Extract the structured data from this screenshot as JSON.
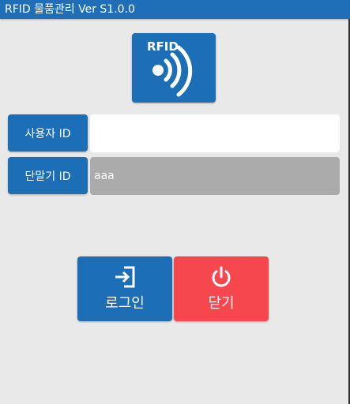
{
  "app": {
    "title": "RFID 물품관리 Ver S1.0.0"
  },
  "logo": {
    "text": "RFID",
    "icon": "rfid-icon"
  },
  "form": {
    "user_id_label": "사용자 ID",
    "user_id_value": "",
    "device_id_label": "단말기 ID",
    "device_id_value": "aaa"
  },
  "buttons": {
    "login_label": "로그인",
    "login_icon": "login-icon",
    "close_label": "닫기",
    "close_icon": "power-icon"
  },
  "colors": {
    "title_bar": "#1e6fb8",
    "primary": "#1c6eb7",
    "danger": "#f7474e",
    "disabled_field": "#ababab",
    "background": "#e9e9e9"
  }
}
